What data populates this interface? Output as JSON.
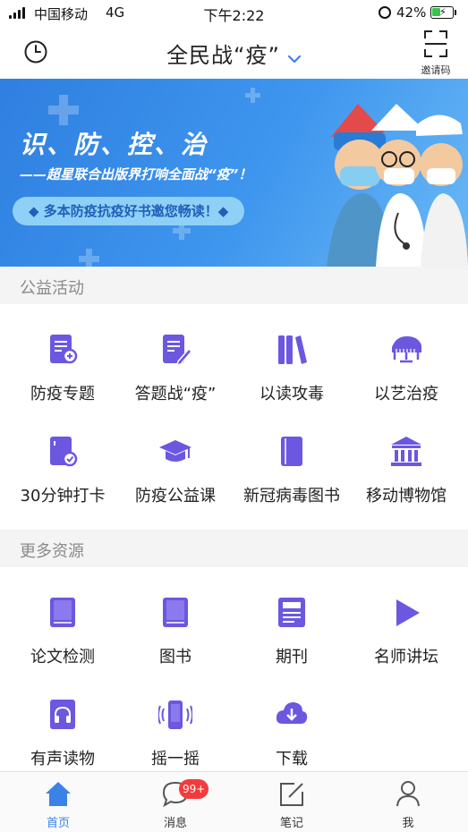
{
  "status_bar": {
    "carrier": "中国移动",
    "network": "4G",
    "time": "下午2:22",
    "battery_percent": "42%",
    "battery_level": 0.42
  },
  "navbar": {
    "title": "全民战“疫”",
    "invite_label": "邀请码"
  },
  "banner": {
    "headline": "识、防、控、治",
    "subline": "——超星联合出版界打响全面战“疫”！",
    "pill": "◆ 多本防疫抗疫好书邀您畅读！◆"
  },
  "sections": {
    "public_welfare": {
      "title": "公益活动",
      "items": [
        {
          "label": "防疫专题",
          "icon": "epidemic-topic-icon"
        },
        {
          "label": "答题战“疫”",
          "icon": "quiz-icon"
        },
        {
          "label": "以读攻毒",
          "icon": "books-icon"
        },
        {
          "label": "以艺治疫",
          "icon": "piano-icon"
        },
        {
          "label": "30分钟打卡",
          "icon": "checkin-book-icon"
        },
        {
          "label": "防疫公益课",
          "icon": "graduation-cap-icon"
        },
        {
          "label": "新冠病毒图书",
          "icon": "book-icon"
        },
        {
          "label": "移动博物馆",
          "icon": "museum-icon"
        }
      ]
    },
    "more_resources": {
      "title": "更多资源",
      "items": [
        {
          "label": "论文检测",
          "icon": "paper-check-icon"
        },
        {
          "label": "图书",
          "icon": "book-icon"
        },
        {
          "label": "期刊",
          "icon": "journal-icon"
        },
        {
          "label": "名师讲坛",
          "icon": "play-icon"
        },
        {
          "label": "有声读物",
          "icon": "audiobook-icon"
        },
        {
          "label": "摇一摇",
          "icon": "shake-phone-icon"
        },
        {
          "label": "下载",
          "icon": "cloud-download-icon"
        }
      ]
    }
  },
  "tabbar": {
    "tabs": [
      {
        "label": "首页",
        "icon": "home-icon",
        "active": true
      },
      {
        "label": "消息",
        "icon": "message-icon",
        "badge": "99+"
      },
      {
        "label": "笔记",
        "icon": "note-icon"
      },
      {
        "label": "我",
        "icon": "person-icon"
      }
    ]
  },
  "colors": {
    "accent_purple": "#6b57e0",
    "active_tab_blue": "#3b82e8",
    "banner_blue": "#2f7fe0",
    "badge_red": "#f33b3b"
  }
}
